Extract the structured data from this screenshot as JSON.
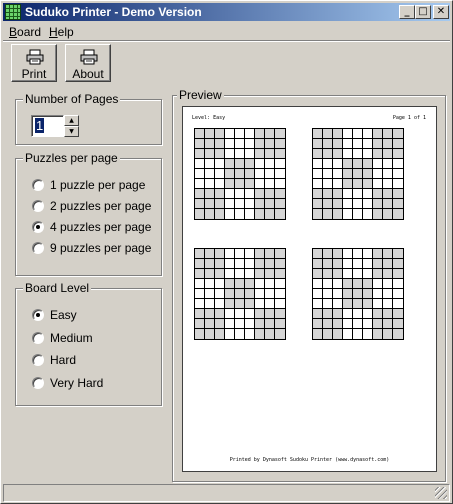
{
  "window": {
    "title": "Suduko Printer - Demo Version",
    "controls": {
      "minimize": "_",
      "maximize": "□",
      "close": "✕"
    },
    "app_icon": "grid-app-icon"
  },
  "menu": [
    {
      "label": "Board",
      "accel": "B",
      "rest": "oard"
    },
    {
      "label": "Help",
      "accel": "H",
      "rest": "elp"
    }
  ],
  "toolbar": {
    "print_label": "Print",
    "about_label": "About",
    "icon": "printer-icon"
  },
  "pages": {
    "title": "Number of Pages",
    "value": "1",
    "up": "▲",
    "down": "▼"
  },
  "puzzles_per_page": {
    "title": "Puzzles per page",
    "options": [
      "1 puzzle per page",
      "2 puzzles per page",
      "4 puzzles per page",
      "9 puzzles per page"
    ],
    "selected": 2
  },
  "board_level": {
    "title": "Board Level",
    "options": [
      "Easy",
      "Medium",
      "Hard",
      "Very Hard"
    ],
    "selected": 0
  },
  "preview": {
    "title": "Preview",
    "level_text": "Level: Easy",
    "page_text": "Page 1 of 1",
    "footer_text": "Printed by Dynasoft Sudoku Printer (www.dynasoft.com)",
    "puzzle_count": 4
  },
  "colors": {
    "title_start": "#0a246a",
    "title_end": "#a6caf0",
    "face": "#d4d0c8",
    "shade_cell": "#d6d6d6"
  }
}
